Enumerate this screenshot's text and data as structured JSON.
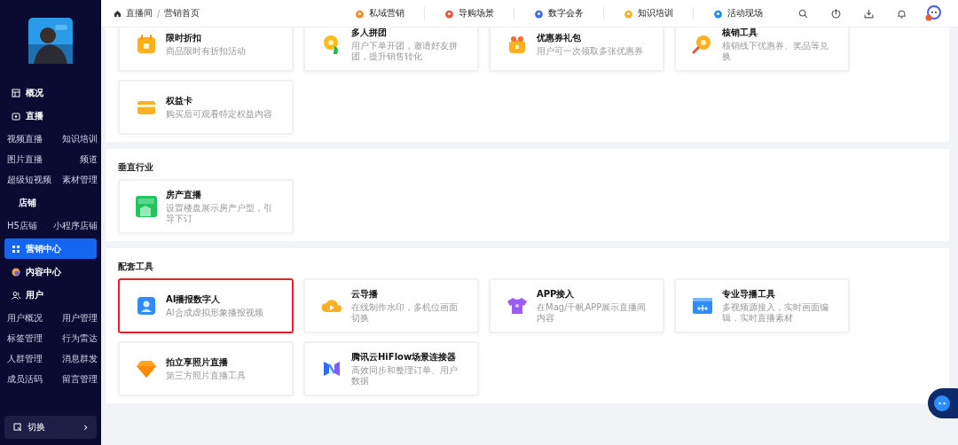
{
  "sidebar": {
    "items": [
      {
        "kind": "main",
        "label": "概况",
        "selected": false
      },
      {
        "kind": "main",
        "label": "直播",
        "selected": false
      },
      {
        "kind": "pair",
        "labels": [
          "视频直播",
          "知识培训"
        ]
      },
      {
        "kind": "pair",
        "labels": [
          "图片直播",
          "频道"
        ]
      },
      {
        "kind": "pair",
        "labels": [
          "超级短视频",
          "素材管理"
        ]
      },
      {
        "kind": "group",
        "label": "店铺",
        "selected": false
      },
      {
        "kind": "pair",
        "labels": [
          "H5店铺",
          "小程序店铺"
        ]
      },
      {
        "kind": "main",
        "label": "营销中心",
        "selected": true
      },
      {
        "kind": "main",
        "label": "内容中心",
        "selected": false
      },
      {
        "kind": "main",
        "label": "用户",
        "selected": false
      },
      {
        "kind": "pair",
        "labels": [
          "用户概况",
          "用户管理"
        ]
      },
      {
        "kind": "pair",
        "labels": [
          "标签管理",
          "行为雷达"
        ]
      },
      {
        "kind": "pair",
        "labels": [
          "人群管理",
          "消息群发"
        ]
      },
      {
        "kind": "pair",
        "labels": [
          "成员活码",
          "留言管理"
        ]
      }
    ],
    "switch": {
      "label": "切换",
      "arrow": "›"
    }
  },
  "breadcrumb": {
    "items": [
      "直播间",
      "营销首页"
    ],
    "separator": "/"
  },
  "nav": [
    "私域营销",
    "导购场景",
    "数字会务",
    "知识培训",
    "活动现场"
  ],
  "sections": [
    {
      "cards": [
        {
          "title": "限时折扣",
          "desc": "商品限时有折扣活动",
          "highlighted": false
        },
        {
          "title": "多人拼团",
          "desc": "用户下单开团，邀请好友拼团，提升销售转化",
          "highlighted": false
        },
        {
          "title": "优惠券礼包",
          "desc": "用户可一次领取多张优惠券",
          "highlighted": false
        },
        {
          "title": "核销工具",
          "desc": "核销线下优惠券、奖品等兑换",
          "highlighted": false
        },
        {
          "title": "权益卡",
          "desc": "购买后可观看特定权益内容",
          "highlighted": false
        }
      ]
    },
    {
      "title": "垂直行业",
      "cards": [
        {
          "title": "房产直播",
          "desc": "设置楼盘展示房产户型，引导下订",
          "highlighted": false
        }
      ]
    },
    {
      "title": "配套工具",
      "cards": [
        {
          "title": "AI播报数字人",
          "desc": "AI合成虚拟形象播报视频",
          "highlighted": true
        },
        {
          "title": "云导播",
          "desc": "在线制作水印，多机位画面切换",
          "highlighted": false
        },
        {
          "title": "APP接入",
          "desc": "在Mag/千帆APP展示直播间内容",
          "highlighted": false
        },
        {
          "title": "专业导播工具",
          "desc": "多视频源接入，实时画面编辑，实时直播素材",
          "highlighted": false
        },
        {
          "title": "拍立享照片直播",
          "desc": "第三方照片直播工具",
          "highlighted": false
        },
        {
          "title": "腾讯云HiFlow场景连接器",
          "desc": "高效同步和整理订单、用户数据",
          "highlighted": false
        }
      ]
    }
  ]
}
